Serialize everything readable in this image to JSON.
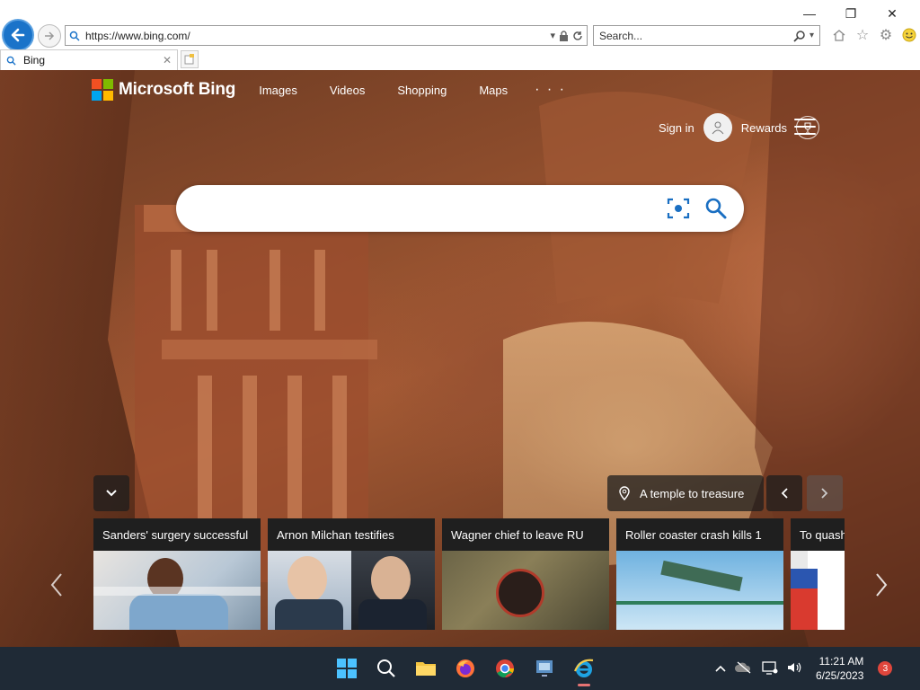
{
  "browser": {
    "address_url": "https://www.bing.com/",
    "search_placeholder": "Search...",
    "tab_title": "Bing",
    "window_controls": [
      "minimize",
      "restore",
      "close"
    ]
  },
  "bing": {
    "brand": "Microsoft Bing",
    "nav_links": [
      "Images",
      "Videos",
      "Shopping",
      "Maps"
    ],
    "more_label": "· · ·",
    "sign_in": "Sign in",
    "rewards": "Rewards",
    "search_value": "",
    "image_caption": "A temple to treasure",
    "logo_colors": [
      "#f25022",
      "#7fba00",
      "#00a4ef",
      "#ffb900"
    ]
  },
  "news_cards": [
    {
      "headline": "Sanders' surgery successful"
    },
    {
      "headline": "Arnon Milchan testifies"
    },
    {
      "headline": "Wagner chief to leave RU"
    },
    {
      "headline": "Roller coaster crash kills 1"
    },
    {
      "headline": "To quash"
    }
  ],
  "taskbar": {
    "apps": [
      "windows-start",
      "search",
      "file-explorer",
      "firefox",
      "chrome",
      "network-app",
      "internet-explorer"
    ],
    "time": "11:21 AM",
    "date": "6/25/2023",
    "notifications": "3"
  }
}
